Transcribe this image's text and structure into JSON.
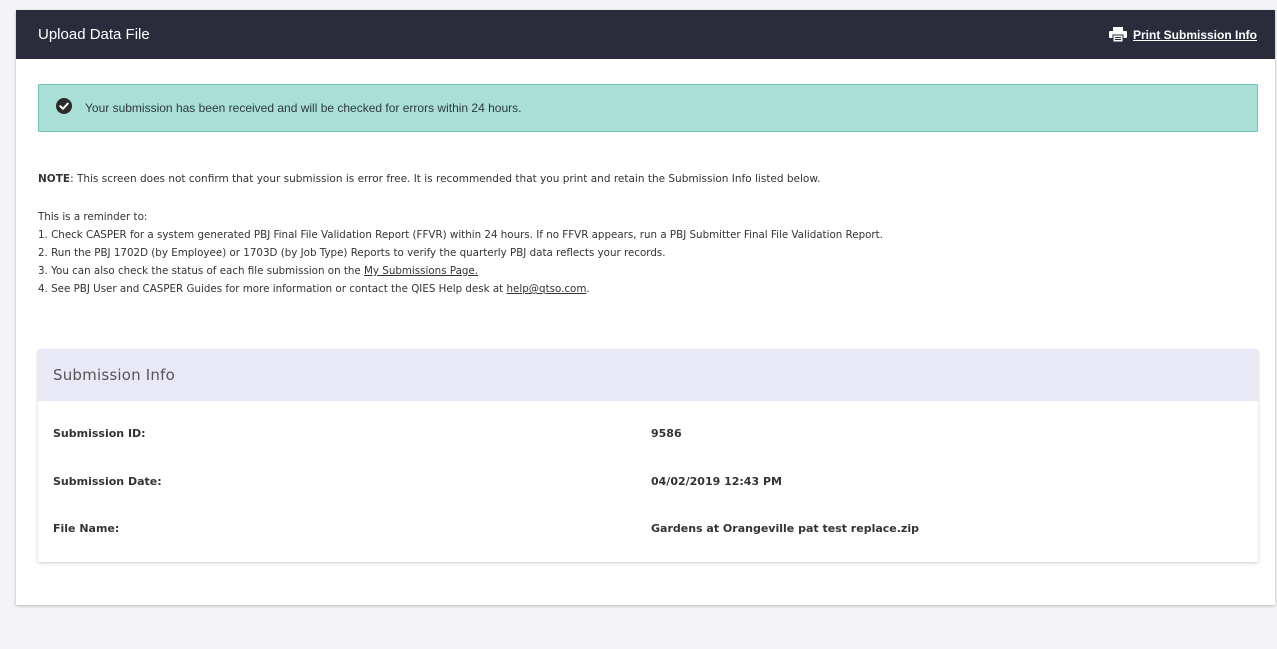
{
  "header": {
    "title": "Upload Data File",
    "print_label": "Print Submission Info",
    "print_icon": "printer-icon"
  },
  "alert": {
    "icon": "check-circle-icon",
    "text": "Your submission has been received and will be checked for errors within 24 hours.",
    "background": "#aadfd6"
  },
  "note": {
    "label": "NOTE",
    "text": ": This screen does not confirm that your submission is error free. It is recommended that you print and retain the Submission Info listed below."
  },
  "reminder": {
    "intro": "This is a reminder to:",
    "items": [
      "1. Check CASPER for a system generated PBJ Final File Validation Report (FFVR) within 24 hours. If no FFVR appears, run a PBJ Submitter Final File Validation Report.",
      "2. Run the PBJ 1702D (by Employee) or 1703D (by Job Type) Reports to verify the quarterly PBJ data reflects your records."
    ],
    "item3_prefix": "3. You can also check the status of each file submission on the ",
    "item3_link": "My Submissions Page.",
    "item4_prefix": "4. See PBJ User and CASPER Guides for more information or contact the QIES Help desk at ",
    "item4_link": "help@qtso.com",
    "item4_suffix": "."
  },
  "submission_info": {
    "title": "Submission Info",
    "rows": [
      {
        "label": "Submission ID:",
        "value": "9586"
      },
      {
        "label": "Submission Date:",
        "value": "04/02/2019 12:43 PM"
      },
      {
        "label": "File Name:",
        "value": "Gardens at Orangeville pat test replace.zip"
      }
    ]
  },
  "colors": {
    "header_bg": "#2b2c3b",
    "info_header_bg": "#e9e8f7",
    "page_bg": "#f4f4f7"
  }
}
